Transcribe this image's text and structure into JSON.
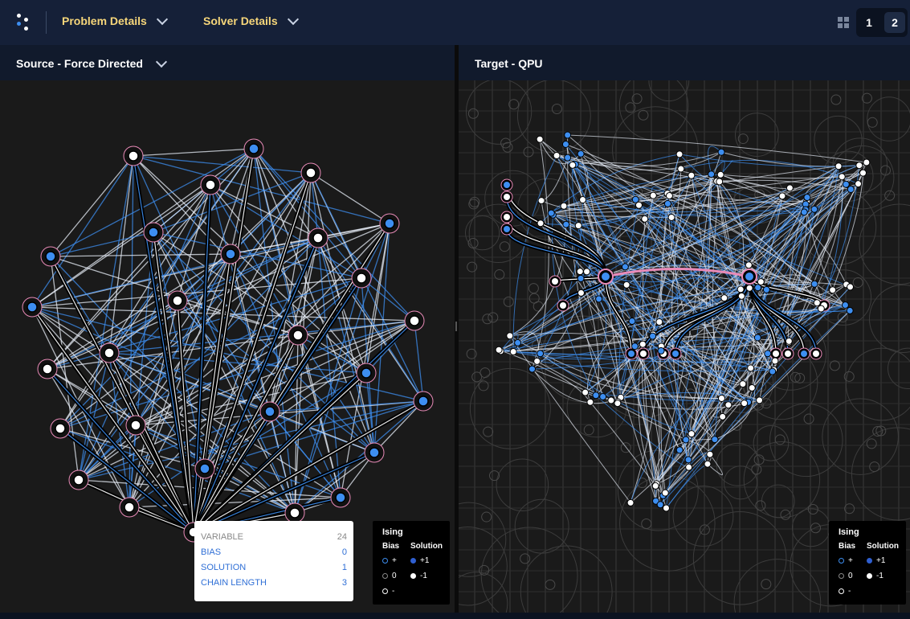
{
  "header": {
    "menus": [
      {
        "label": "Problem Details"
      },
      {
        "label": "Solver Details"
      }
    ],
    "pages": [
      "1",
      "2"
    ],
    "active_page": "2"
  },
  "panels": {
    "source": {
      "title": "Source - Force Directed"
    },
    "target": {
      "title": "Target - QPU"
    }
  },
  "tooltip": {
    "rows": [
      {
        "key": "VARIABLE",
        "value": "24"
      },
      {
        "key": "BIAS",
        "value": "0"
      },
      {
        "key": "SOLUTION",
        "value": "1"
      },
      {
        "key": "CHAIN LENGTH",
        "value": "3"
      }
    ]
  },
  "legend": {
    "title": "Ising",
    "bias_header": "Bias",
    "solution_header": "Solution",
    "bias_items": [
      "+",
      "0",
      "-"
    ],
    "solution_items": [
      "+1",
      "-1"
    ]
  },
  "colors": {
    "accent_blue": "#3d8ef0",
    "node_white": "#ffffff",
    "highlight_pink": "#e98bb8",
    "menu_yellow": "#f6d67a"
  }
}
